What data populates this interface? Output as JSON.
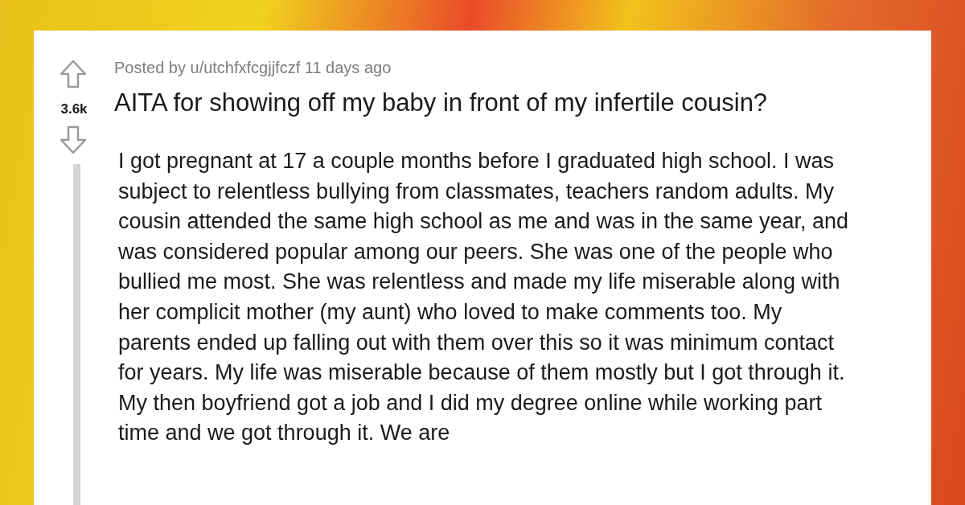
{
  "post": {
    "votes": "3.6k",
    "meta": "Posted by u/utchfxfcgjjfczf 11 days ago",
    "title": "AITA for showing off my baby in front of my infertile cousin?",
    "body": "I got pregnant at 17 a couple months before I graduated high school. I was subject to relentless bullying from classmates, teachers random adults. My cousin attended the same high school as me and was in the same year, and was considered popular among our peers. She was one of the people who bullied me most. She was relentless and made my life miserable along with her complicit mother (my aunt) who loved to make comments too. My parents ended up falling out with them over this so it was minimum contact for years. My life was miserable because of them mostly but I got through it. My then boyfriend got a job and I did my degree online while working part time and we got through it. We are"
  }
}
